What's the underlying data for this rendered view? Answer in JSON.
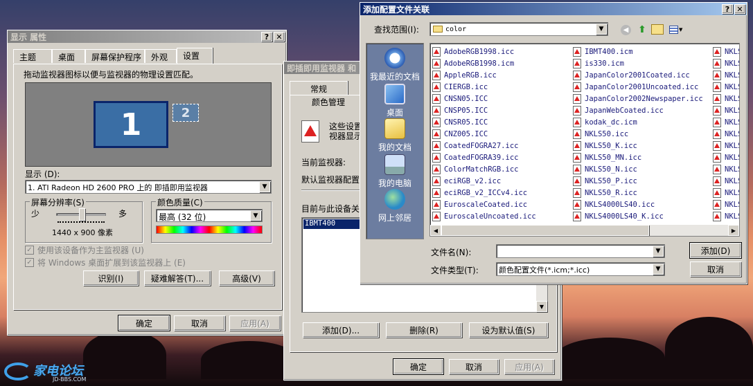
{
  "display_props": {
    "title": "显示 属性",
    "tabs": [
      "主题",
      "桌面",
      "屏幕保护程序",
      "外观",
      "设置"
    ],
    "instruction": "拖动监视器图标以便与监视器的物理设置匹配。",
    "monitor1": "1",
    "monitor2": "2",
    "display_label": "显示 (D):",
    "display_value": "1. ATI Radeon HD 2600 PRO 上的 即插即用监视器",
    "resolution_group": "屏幕分辨率(S)",
    "res_less": "少",
    "res_more": "多",
    "res_value": "1440 x 900 像素",
    "resolution_slider_fraction": 0.5,
    "color_group": "颜色质量(C)",
    "color_value": "最高 (32 位)",
    "check_primary": "使用该设备作为主监视器 (U)",
    "check_extend": "将 Windows 桌面扩展到该监视器上 (E)",
    "btn_identify": "识别(I)",
    "btn_troubleshoot": "疑难解答(T)...",
    "btn_advanced": "高级(V)",
    "btn_ok": "确定",
    "btn_cancel": "取消",
    "btn_apply": "应用(A)"
  },
  "pnp_props": {
    "title": "即插即用监视器 和",
    "tabs": [
      "常规",
      "颜色管理"
    ],
    "desc_line1": "这些设置",
    "desc_line2": "视器显示",
    "current_monitor": "当前监视器:",
    "default_profile": "默认监视器配置",
    "assoc_label": "目前与此设备关",
    "list_item": "IBMT400",
    "btn_add": "添加(D)...",
    "btn_delete": "删除(R)",
    "btn_set_default": "设为默认值(S)",
    "btn_ok": "确定",
    "btn_cancel": "取消",
    "btn_apply": "应用(A)"
  },
  "add_profile": {
    "title": "添加配置文件关联",
    "lookin_label": "查找范围(I):",
    "lookin_value": "color",
    "places": [
      "我最近的文档",
      "桌面",
      "我的文档",
      "我的电脑",
      "网上邻居"
    ],
    "files_col1": [
      "AdobeRGB1998.icc",
      "AdobeRGB1998.icm",
      "AppleRGB.icc",
      "CIERGB.icc",
      "CNSN05.ICC",
      "CNSP05.ICC",
      "CNSR05.ICC",
      "CNZ005.ICC",
      "CoatedFOGRA27.icc",
      "CoatedFOGRA39.icc",
      "ColorMatchRGB.icc",
      "eciRGB_v2.icc",
      "eciRGB_v2_ICCv4.icc",
      "EuroscaleCoated.icc",
      "EuroscaleUncoated.icc"
    ],
    "files_col2": [
      "IBMT400.icm",
      "is330.icm",
      "JapanColor2001Coated.icc",
      "JapanColor2001Uncoated.icc",
      "JapanColor2002Newspaper.icc",
      "JapanWebCoated.icc",
      "kodak_dc.icm",
      "NKLS50.icc",
      "NKLS50_K.icc",
      "NKLS50_MN.icc",
      "NKLS50_N.icc",
      "NKLS50_P.icc",
      "NKLS50_R.icc",
      "NKLS4000LS40.icc",
      "NKLS4000LS40_K.icc"
    ],
    "files_col3": [
      "NKLS",
      "NKLS",
      "NKLS",
      "NKLS",
      "NKLS",
      "NKLS",
      "NKLS",
      "NKLS",
      "NKLS",
      "NKLS",
      "NKLS",
      "NKLS",
      "NKLS",
      "NKLS",
      "NKLS"
    ],
    "filename_label": "文件名(N):",
    "filename_value": "",
    "filetype_label": "文件类型(T):",
    "filetype_value": "颜色配置文件(*.icm;*.icc)",
    "btn_add": "添加(D)",
    "btn_cancel": "取消"
  },
  "watermark": {
    "main": "家电论坛",
    "sub": "JD-BBS.COM"
  },
  "colors": {
    "title_active": "#0a246a",
    "monitor_blue": "#3a6ea5",
    "selection": "#0a246a",
    "places_bar": "#6c7da0"
  }
}
